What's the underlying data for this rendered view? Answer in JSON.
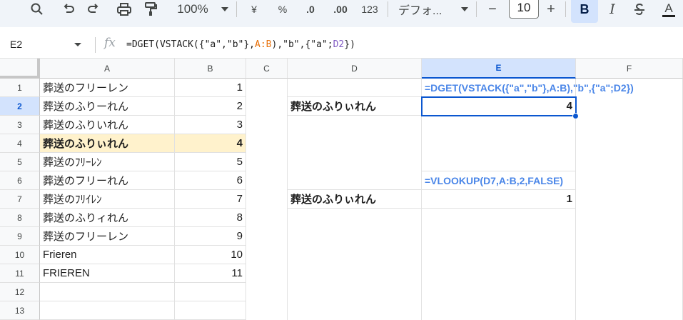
{
  "toolbar": {
    "zoom": "100%",
    "currency": "¥",
    "percent": "%",
    "dec_decrease": ".0",
    "dec_increase": ".00",
    "number_format": "123",
    "font_name": "デフォ...",
    "font_size": "10",
    "minus": "−",
    "plus": "+",
    "bold": "B",
    "italic": "I",
    "text_color": "A"
  },
  "formula_bar": {
    "cell_ref": "E2",
    "fx": "fx",
    "formula_pre": "=DGET(VSTACK({\"a\",\"b\"},",
    "formula_range": "A:B",
    "formula_mid": "),\"b\",{\"a\";",
    "formula_ref": "D2",
    "formula_post": "})"
  },
  "columns": [
    "A",
    "B",
    "C",
    "D",
    "E",
    "F"
  ],
  "rows": [
    "1",
    "2",
    "3",
    "4",
    "5",
    "6",
    "7",
    "8",
    "9",
    "10",
    "11",
    "12",
    "13"
  ],
  "cells": {
    "A1": "葬送のフリーレン",
    "A2": "葬送のふりーれん",
    "A3": "葬送のふりいれん",
    "A4": "葬送のふりぃれん",
    "A5": "葬送のﾌﾘｰﾚﾝ",
    "A6": "葬送のフリーれん",
    "A7": "葬送のﾌﾘｲﾚﾝ",
    "A8": "葬送のふりィれん",
    "A9": "葬送のフリーレン",
    "A10": "Frieren",
    "A11": "FRIEREN",
    "B1": "1",
    "B2": "2",
    "B3": "3",
    "B4": "4",
    "B5": "5",
    "B6": "6",
    "B7": "7",
    "B8": "8",
    "B9": "9",
    "B10": "10",
    "B11": "11",
    "D2": "葬送のふりぃれん",
    "D7": "葬送のふりぃれん",
    "E1": "=DGET(VSTACK({\"a\",\"b\"},A:B),\"b\",{\"a\";D2})",
    "E2": "4",
    "E6": "=VLOOKUP(D7,A:B,2,FALSE)",
    "E7": "1"
  },
  "colors": {
    "accent": "#0b57d0",
    "highlight": "#fff2cc",
    "formula_text": "#4a86e8"
  }
}
